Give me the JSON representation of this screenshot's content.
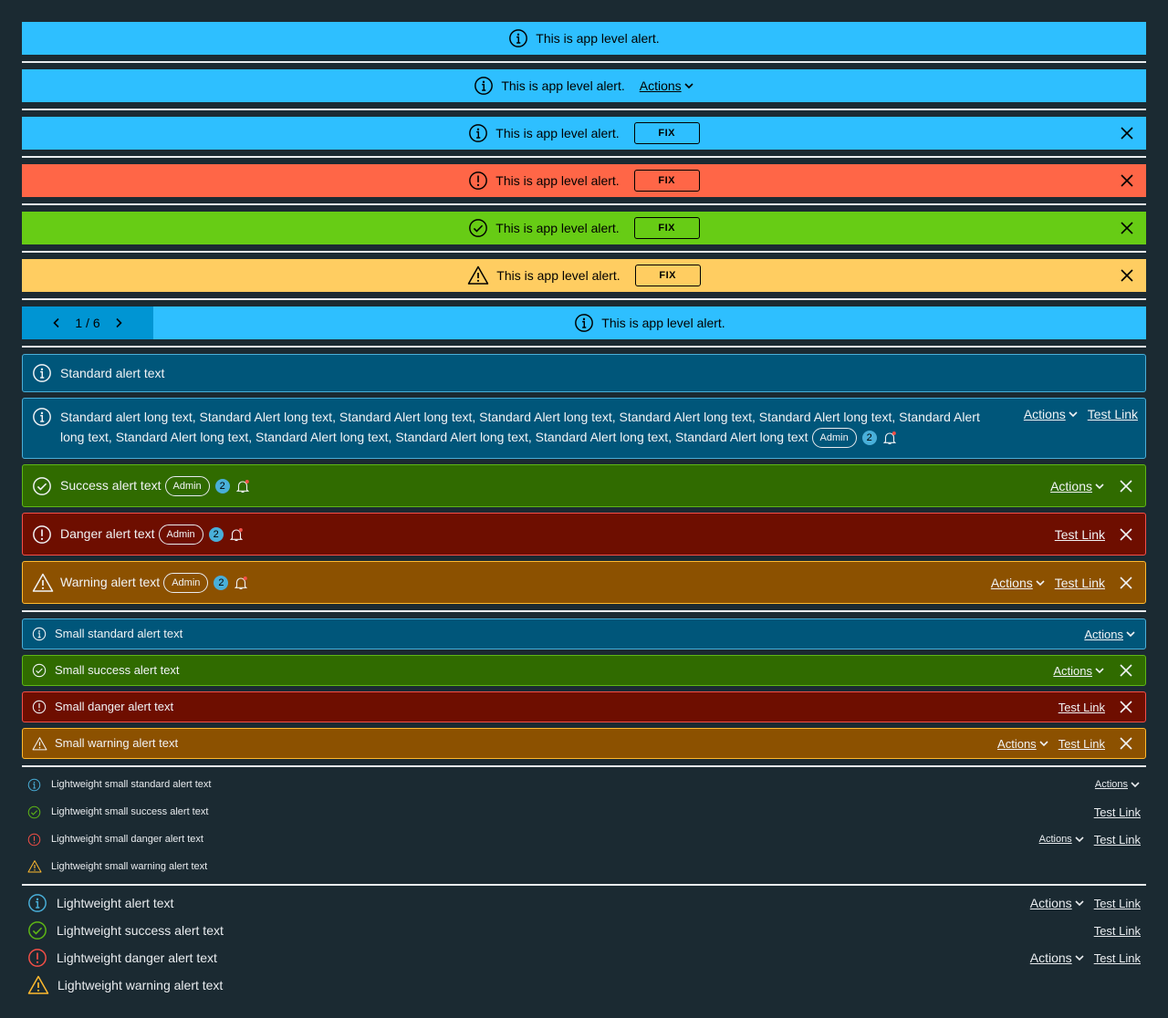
{
  "app_alerts": {
    "message": "This is app level alert.",
    "actions_label": "Actions",
    "fix_label": "FIX",
    "pager": "1 / 6"
  },
  "standard": {
    "info_text": "Standard alert text",
    "long_text": "Standard alert long text, Standard Alert long text, Standard Alert long text, Standard Alert long text, Standard Alert long text, Standard Alert long text, Standard Alert long text, Standard Alert long text, Standard Alert long text, Standard Alert long text, Standard Alert long text, Standard Alert long text",
    "success_text": "Success alert text",
    "danger_text": "Danger alert text",
    "warning_text": "Warning alert text",
    "actions_label": "Actions",
    "test_link": "Test Link",
    "admin_label": "Admin",
    "badge_count": "2"
  },
  "small": {
    "info_text": "Small standard alert text",
    "success_text": "Small success alert text",
    "danger_text": "Small danger alert text",
    "warning_text": "Small warning alert text",
    "actions_label": "Actions",
    "test_link": "Test Link"
  },
  "lightweight_small": {
    "info_text": "Lightweight small standard alert text",
    "success_text": "Lightweight small success alert text",
    "danger_text": "Lightweight small danger alert text",
    "warning_text": "Lightweight small warning alert text",
    "actions_label": "Actions",
    "test_link": "Test Link"
  },
  "lightweight": {
    "info_text": "Lightweight alert text",
    "success_text": "Lightweight success alert text",
    "danger_text": "Lightweight danger alert text",
    "warning_text": "Lightweight warning alert text",
    "actions_label": "Actions",
    "test_link": "Test Link"
  },
  "colors": {
    "app_info": "#2ebfff",
    "app_danger": "#ff6647",
    "app_success": "#67cc15",
    "app_warning": "#ffcd61",
    "alert_info": "#00567a",
    "alert_success": "#306b00",
    "alert_danger": "#6e0e00",
    "alert_warning": "#8c5100",
    "background": "#1b2a32"
  },
  "icons": [
    "info-icon",
    "error-icon",
    "success-icon",
    "warning-icon",
    "close-icon",
    "chevron-down-icon",
    "chevron-left-icon",
    "chevron-right-icon",
    "bell-icon"
  ]
}
